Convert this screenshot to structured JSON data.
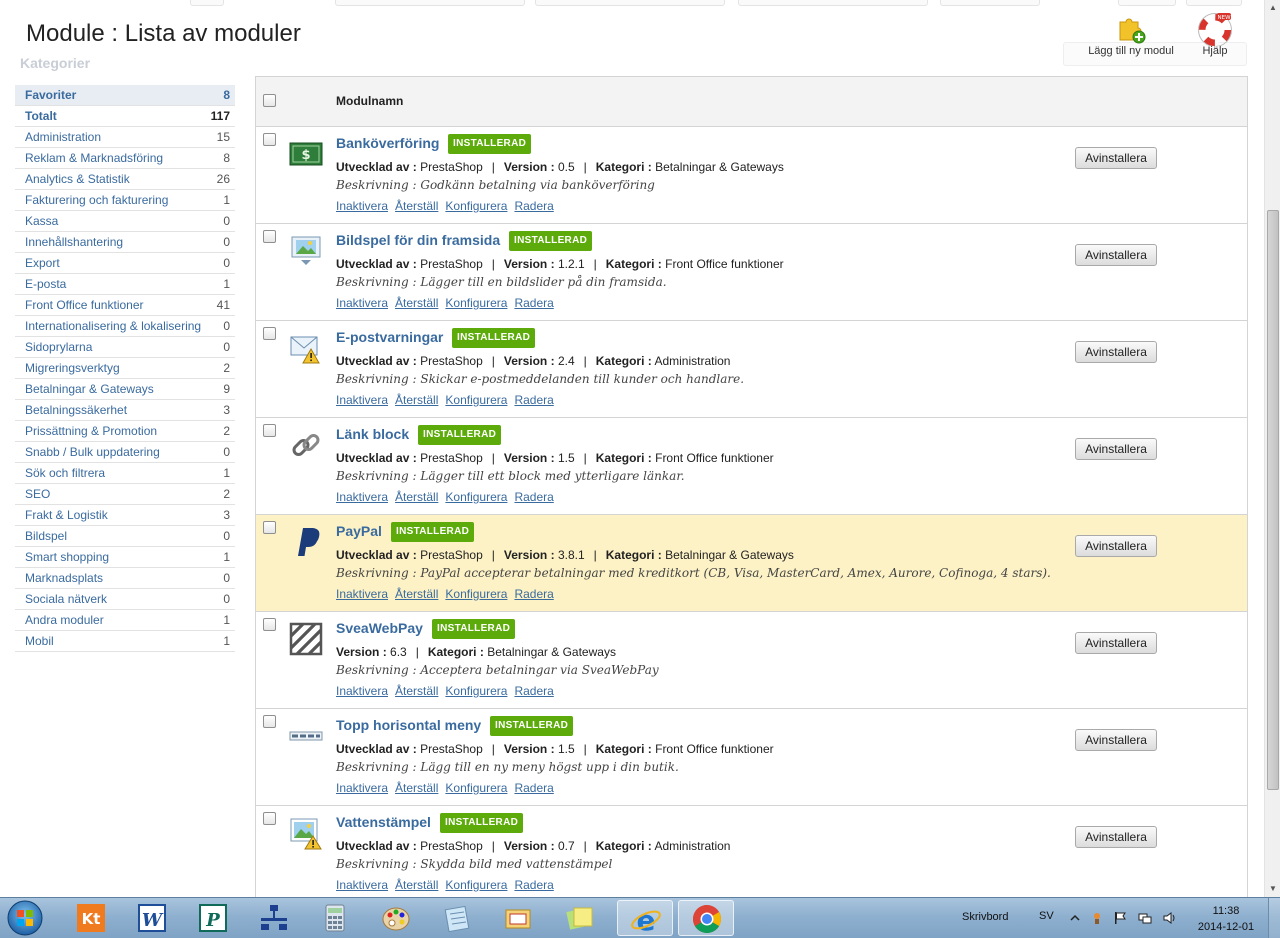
{
  "header": {
    "title": "Module : Lista av moduler",
    "add_module_label": "Lägg till ny modul",
    "help_label": "Hjälp",
    "ghost_categories_label": "Kategorier"
  },
  "sidebar": {
    "categories": [
      {
        "name": "Favoriter",
        "count": "8"
      },
      {
        "name": "Totalt",
        "count": "117"
      },
      {
        "name": "Administration",
        "count": "15"
      },
      {
        "name": "Reklam & Marknadsföring",
        "count": "8"
      },
      {
        "name": "Analytics & Statistik",
        "count": "26"
      },
      {
        "name": "Fakturering och fakturering",
        "count": "1"
      },
      {
        "name": "Kassa",
        "count": "0"
      },
      {
        "name": "Innehållshantering",
        "count": "0"
      },
      {
        "name": "Export",
        "count": "0"
      },
      {
        "name": "E-posta",
        "count": "1"
      },
      {
        "name": "Front Office funktioner",
        "count": "41"
      },
      {
        "name": "Internationalisering & lokalisering",
        "count": "0"
      },
      {
        "name": "Sidoprylarna",
        "count": "0"
      },
      {
        "name": "Migreringsverktyg",
        "count": "2"
      },
      {
        "name": "Betalningar & Gateways",
        "count": "9"
      },
      {
        "name": "Betalningssäkerhet",
        "count": "3"
      },
      {
        "name": "Prissättning & Promotion",
        "count": "2"
      },
      {
        "name": "Snabb / Bulk uppdatering",
        "count": "0"
      },
      {
        "name": "Sök och filtrera",
        "count": "1"
      },
      {
        "name": "SEO",
        "count": "2"
      },
      {
        "name": "Frakt & Logistik",
        "count": "3"
      },
      {
        "name": "Bildspel",
        "count": "0"
      },
      {
        "name": "Smart shopping",
        "count": "1"
      },
      {
        "name": "Marknadsplats",
        "count": "0"
      },
      {
        "name": "Sociala nätverk",
        "count": "0"
      },
      {
        "name": "Andra moduler",
        "count": "1"
      },
      {
        "name": "Mobil",
        "count": "1"
      }
    ]
  },
  "table": {
    "column_header": "Modulnamn",
    "labels": {
      "developed_by": "Utvecklad av :",
      "version": "Version :",
      "category": "Kategori :",
      "description": "Beskrivning :",
      "installed": "INSTALLERAD",
      "deactivate": "Inaktivera",
      "reset": "Återställ",
      "configure": "Konfigurera",
      "delete": "Radera",
      "uninstall": "Avinstallera",
      "separator": "|"
    },
    "modules": [
      {
        "name": "Banköverföring",
        "author": "PrestaShop",
        "version": "0.5",
        "category": "Betalningar & Gateways",
        "description": "Godkänn betalning via banköverföring",
        "icon": "banknote-icon"
      },
      {
        "name": "Bildspel för din framsida",
        "author": "PrestaShop",
        "version": "1.2.1",
        "category": "Front Office funktioner",
        "description": "Lägger till en bildslider på din framsida.",
        "icon": "slideshow-icon"
      },
      {
        "name": "E-postvarningar",
        "author": "PrestaShop",
        "version": "2.4",
        "category": "Administration",
        "description": "Skickar e-postmeddelanden till kunder och handlare.",
        "icon": "mail-warning-icon"
      },
      {
        "name": "Länk block",
        "author": "PrestaShop",
        "version": "1.5",
        "category": "Front Office funktioner",
        "description": "Lägger till ett block med ytterligare länkar.",
        "icon": "chain-link-icon"
      },
      {
        "name": "PayPal",
        "author": "PrestaShop",
        "version": "3.8.1",
        "category": "Betalningar & Gateways",
        "description": "PayPal accepterar betalningar med kreditkort (CB, Visa, MasterCard, Amex, Aurore, Cofinoga, 4 stars).",
        "icon": "paypal-icon",
        "highlight": true
      },
      {
        "name": "SveaWebPay",
        "author": "",
        "version": "6.3",
        "category": "Betalningar & Gateways",
        "description": "Acceptera betalningar via SveaWebPay",
        "icon": "svea-icon"
      },
      {
        "name": "Topp horisontal meny",
        "author": "PrestaShop",
        "version": "1.5",
        "category": "Front Office funktioner",
        "description": "Lägg till en ny meny högst upp i din butik.",
        "icon": "menu-bar-icon"
      },
      {
        "name": "Vattenstämpel",
        "author": "PrestaShop",
        "version": "0.7",
        "category": "Administration",
        "description": "Skydda bild med vattenstämpel",
        "icon": "watermark-icon"
      }
    ]
  },
  "taskbar": {
    "desktop_label": "Skrivbord",
    "language": "SV",
    "time": "11:38",
    "date": "2014-12-01"
  },
  "colors": {
    "link": "#3a6b9f",
    "installed_badge": "#5cab0a",
    "highlight_row": "#fdf2c6"
  }
}
